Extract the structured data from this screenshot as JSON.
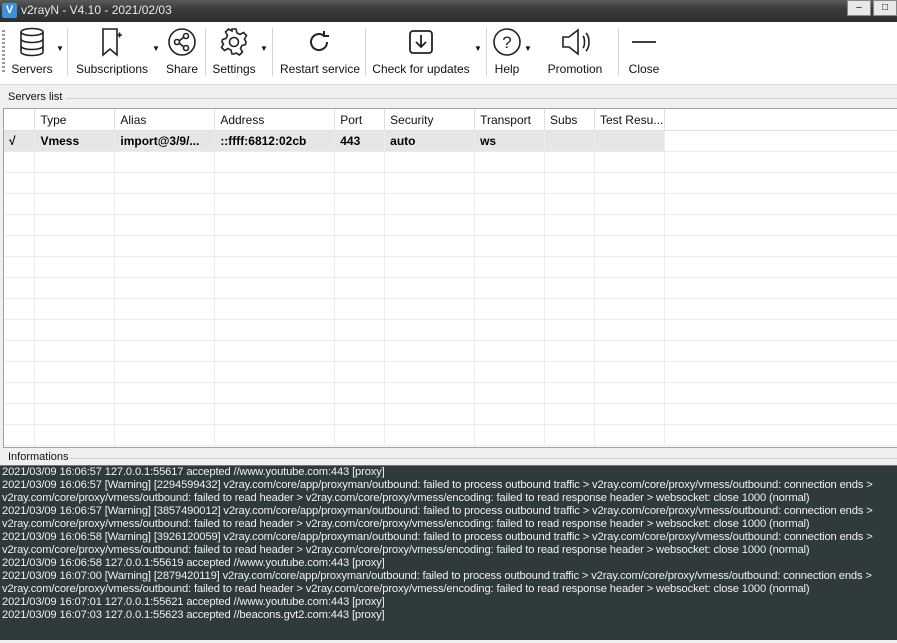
{
  "window": {
    "title": "v2rayN - V4.10 - 2021/02/03",
    "icon": "v2rayn-logo-icon"
  },
  "toolbar": {
    "servers": "Servers",
    "subscriptions": "Subscriptions",
    "share": "Share",
    "settings": "Settings",
    "restart": "Restart service",
    "check_updates": "Check for updates",
    "help": "Help",
    "promotion": "Promotion",
    "close": "Close"
  },
  "servers_list": {
    "label": "Servers list",
    "columns": [
      "",
      "Type",
      "Alias",
      "Address",
      "Port",
      "Security",
      "Transport",
      "Subs",
      "Test Resu..."
    ],
    "rows": [
      [
        "√",
        "Vmess",
        "import@3/9/...",
        "::ffff:6812:02cb",
        "443",
        "auto",
        "ws",
        "",
        ""
      ]
    ]
  },
  "informations": {
    "label": "Informations",
    "lines": [
      "2021/03/09 16:06:57 127.0.0.1:55617 accepted //www.youtube.com:443 [proxy]",
      "2021/03/09 16:06:57 [Warning] [2294599432] v2ray.com/core/app/proxyman/outbound: failed to process outbound traffic > v2ray.com/core/proxy/vmess/outbound: connection ends >",
      "v2ray.com/core/proxy/vmess/outbound: failed to read header > v2ray.com/core/proxy/vmess/encoding: failed to read response header > websocket: close 1000 (normal)",
      "2021/03/09 16:06:57 [Warning] [3857490012] v2ray.com/core/app/proxyman/outbound: failed to process outbound traffic > v2ray.com/core/proxy/vmess/outbound: connection ends >",
      "v2ray.com/core/proxy/vmess/outbound: failed to read header > v2ray.com/core/proxy/vmess/encoding: failed to read response header > websocket: close 1000 (normal)",
      "2021/03/09 16:06:58 [Warning] [3926120059] v2ray.com/core/app/proxyman/outbound: failed to process outbound traffic > v2ray.com/core/proxy/vmess/outbound: connection ends >",
      "v2ray.com/core/proxy/vmess/outbound: failed to read header > v2ray.com/core/proxy/vmess/encoding: failed to read response header > websocket: close 1000 (normal)",
      "2021/03/09 16:06:58 127.0.0.1:55619 accepted //www.youtube.com:443 [proxy]",
      "2021/03/09 16:07:00 [Warning] [2879420119] v2ray.com/core/app/proxyman/outbound: failed to process outbound traffic > v2ray.com/core/proxy/vmess/outbound: connection ends >",
      "v2ray.com/core/proxy/vmess/outbound: failed to read header > v2ray.com/core/proxy/vmess/encoding: failed to read response header > websocket: close 1000 (normal)",
      "2021/03/09 16:07:01 127.0.0.1:55621 accepted //www.youtube.com:443 [proxy]",
      "2021/03/09 16:07:03 127.0.0.1:55623 accepted //beacons.gvt2.com:443 [proxy]"
    ]
  },
  "colors": {
    "log_background": "#2f3a3a",
    "log_text": "#f0f0f0",
    "selected_row": "#e6e6e6"
  }
}
